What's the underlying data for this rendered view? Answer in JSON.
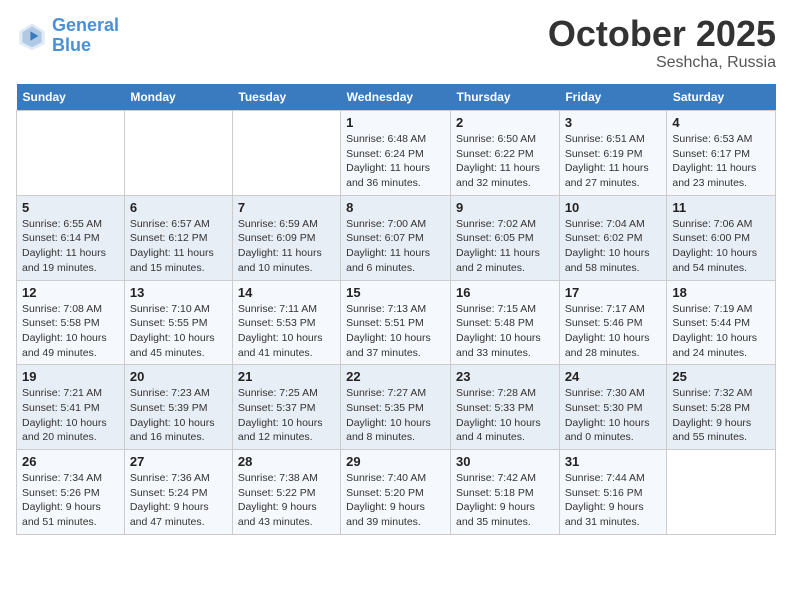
{
  "logo": {
    "line1": "General",
    "line2": "Blue"
  },
  "title": "October 2025",
  "subtitle": "Seshcha, Russia",
  "days_of_week": [
    "Sunday",
    "Monday",
    "Tuesday",
    "Wednesday",
    "Thursday",
    "Friday",
    "Saturday"
  ],
  "weeks": [
    [
      {
        "day": "",
        "info": ""
      },
      {
        "day": "",
        "info": ""
      },
      {
        "day": "",
        "info": ""
      },
      {
        "day": "1",
        "info": "Sunrise: 6:48 AM\nSunset: 6:24 PM\nDaylight: 11 hours\nand 36 minutes."
      },
      {
        "day": "2",
        "info": "Sunrise: 6:50 AM\nSunset: 6:22 PM\nDaylight: 11 hours\nand 32 minutes."
      },
      {
        "day": "3",
        "info": "Sunrise: 6:51 AM\nSunset: 6:19 PM\nDaylight: 11 hours\nand 27 minutes."
      },
      {
        "day": "4",
        "info": "Sunrise: 6:53 AM\nSunset: 6:17 PM\nDaylight: 11 hours\nand 23 minutes."
      }
    ],
    [
      {
        "day": "5",
        "info": "Sunrise: 6:55 AM\nSunset: 6:14 PM\nDaylight: 11 hours\nand 19 minutes."
      },
      {
        "day": "6",
        "info": "Sunrise: 6:57 AM\nSunset: 6:12 PM\nDaylight: 11 hours\nand 15 minutes."
      },
      {
        "day": "7",
        "info": "Sunrise: 6:59 AM\nSunset: 6:09 PM\nDaylight: 11 hours\nand 10 minutes."
      },
      {
        "day": "8",
        "info": "Sunrise: 7:00 AM\nSunset: 6:07 PM\nDaylight: 11 hours\nand 6 minutes."
      },
      {
        "day": "9",
        "info": "Sunrise: 7:02 AM\nSunset: 6:05 PM\nDaylight: 11 hours\nand 2 minutes."
      },
      {
        "day": "10",
        "info": "Sunrise: 7:04 AM\nSunset: 6:02 PM\nDaylight: 10 hours\nand 58 minutes."
      },
      {
        "day": "11",
        "info": "Sunrise: 7:06 AM\nSunset: 6:00 PM\nDaylight: 10 hours\nand 54 minutes."
      }
    ],
    [
      {
        "day": "12",
        "info": "Sunrise: 7:08 AM\nSunset: 5:58 PM\nDaylight: 10 hours\nand 49 minutes."
      },
      {
        "day": "13",
        "info": "Sunrise: 7:10 AM\nSunset: 5:55 PM\nDaylight: 10 hours\nand 45 minutes."
      },
      {
        "day": "14",
        "info": "Sunrise: 7:11 AM\nSunset: 5:53 PM\nDaylight: 10 hours\nand 41 minutes."
      },
      {
        "day": "15",
        "info": "Sunrise: 7:13 AM\nSunset: 5:51 PM\nDaylight: 10 hours\nand 37 minutes."
      },
      {
        "day": "16",
        "info": "Sunrise: 7:15 AM\nSunset: 5:48 PM\nDaylight: 10 hours\nand 33 minutes."
      },
      {
        "day": "17",
        "info": "Sunrise: 7:17 AM\nSunset: 5:46 PM\nDaylight: 10 hours\nand 28 minutes."
      },
      {
        "day": "18",
        "info": "Sunrise: 7:19 AM\nSunset: 5:44 PM\nDaylight: 10 hours\nand 24 minutes."
      }
    ],
    [
      {
        "day": "19",
        "info": "Sunrise: 7:21 AM\nSunset: 5:41 PM\nDaylight: 10 hours\nand 20 minutes."
      },
      {
        "day": "20",
        "info": "Sunrise: 7:23 AM\nSunset: 5:39 PM\nDaylight: 10 hours\nand 16 minutes."
      },
      {
        "day": "21",
        "info": "Sunrise: 7:25 AM\nSunset: 5:37 PM\nDaylight: 10 hours\nand 12 minutes."
      },
      {
        "day": "22",
        "info": "Sunrise: 7:27 AM\nSunset: 5:35 PM\nDaylight: 10 hours\nand 8 minutes."
      },
      {
        "day": "23",
        "info": "Sunrise: 7:28 AM\nSunset: 5:33 PM\nDaylight: 10 hours\nand 4 minutes."
      },
      {
        "day": "24",
        "info": "Sunrise: 7:30 AM\nSunset: 5:30 PM\nDaylight: 10 hours\nand 0 minutes."
      },
      {
        "day": "25",
        "info": "Sunrise: 7:32 AM\nSunset: 5:28 PM\nDaylight: 9 hours\nand 55 minutes."
      }
    ],
    [
      {
        "day": "26",
        "info": "Sunrise: 7:34 AM\nSunset: 5:26 PM\nDaylight: 9 hours\nand 51 minutes."
      },
      {
        "day": "27",
        "info": "Sunrise: 7:36 AM\nSunset: 5:24 PM\nDaylight: 9 hours\nand 47 minutes."
      },
      {
        "day": "28",
        "info": "Sunrise: 7:38 AM\nSunset: 5:22 PM\nDaylight: 9 hours\nand 43 minutes."
      },
      {
        "day": "29",
        "info": "Sunrise: 7:40 AM\nSunset: 5:20 PM\nDaylight: 9 hours\nand 39 minutes."
      },
      {
        "day": "30",
        "info": "Sunrise: 7:42 AM\nSunset: 5:18 PM\nDaylight: 9 hours\nand 35 minutes."
      },
      {
        "day": "31",
        "info": "Sunrise: 7:44 AM\nSunset: 5:16 PM\nDaylight: 9 hours\nand 31 minutes."
      },
      {
        "day": "",
        "info": ""
      }
    ]
  ]
}
